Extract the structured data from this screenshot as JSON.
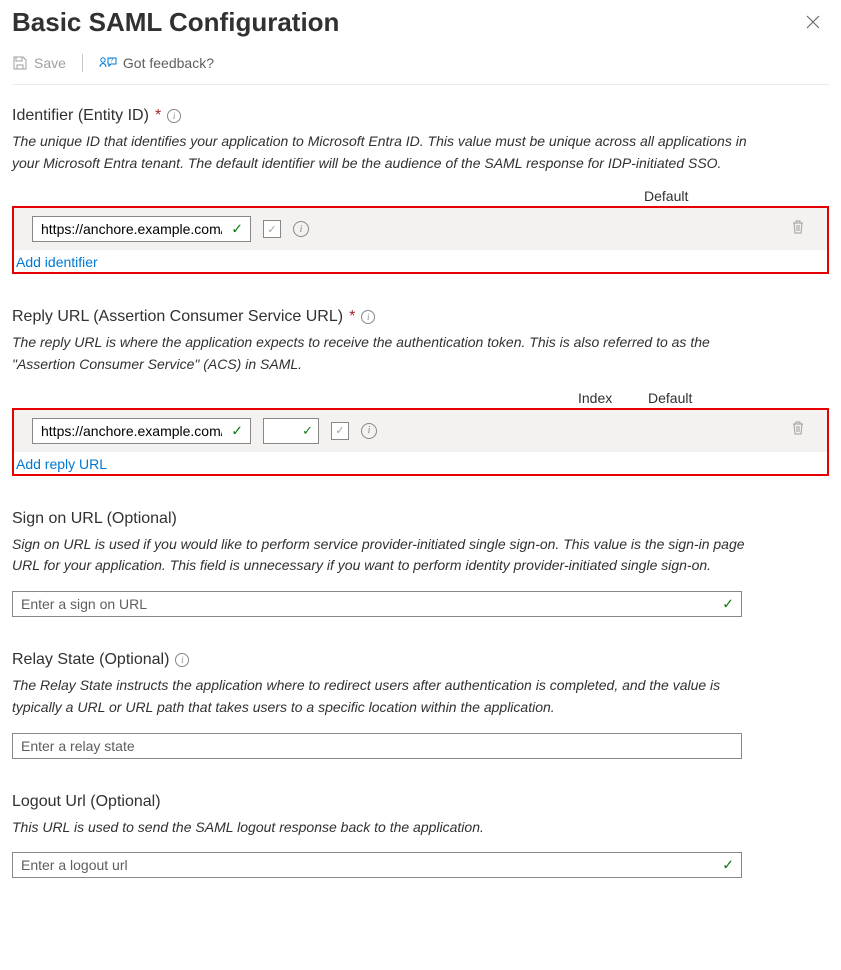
{
  "header": {
    "title": "Basic SAML Configuration"
  },
  "toolbar": {
    "save_label": "Save",
    "feedback_label": "Got feedback?"
  },
  "identifier": {
    "label": "Identifier (Entity ID)",
    "desc": "The unique ID that identifies your application to Microsoft Entra ID. This value must be unique across all applications in your Microsoft Entra tenant. The default identifier will be the audience of the SAML response for IDP-initiated SSO.",
    "col_default": "Default",
    "value": "https://anchore.example.com/service/sso/auth/azure",
    "add_link": "Add identifier"
  },
  "reply": {
    "label": "Reply URL (Assertion Consumer Service URL)",
    "desc": "The reply URL is where the application expects to receive the authentication token. This is also referred to as the \"Assertion Consumer Service\" (ACS) in SAML.",
    "col_index": "Index",
    "col_default": "Default",
    "value": "https://anchore.example.com/service/sso/auth/azure",
    "index_value": "",
    "add_link": "Add reply URL"
  },
  "signon": {
    "label": "Sign on URL (Optional)",
    "desc": "Sign on URL is used if you would like to perform service provider-initiated single sign-on. This value is the sign-in page URL for your application. This field is unnecessary if you want to perform identity provider-initiated single sign-on.",
    "placeholder": "Enter a sign on URL"
  },
  "relay": {
    "label": "Relay State (Optional)",
    "desc": "The Relay State instructs the application where to redirect users after authentication is completed, and the value is typically a URL or URL path that takes users to a specific location within the application.",
    "placeholder": "Enter a relay state"
  },
  "logout": {
    "label": "Logout Url (Optional)",
    "desc": "This URL is used to send the SAML logout response back to the application.",
    "placeholder": "Enter a logout url"
  }
}
